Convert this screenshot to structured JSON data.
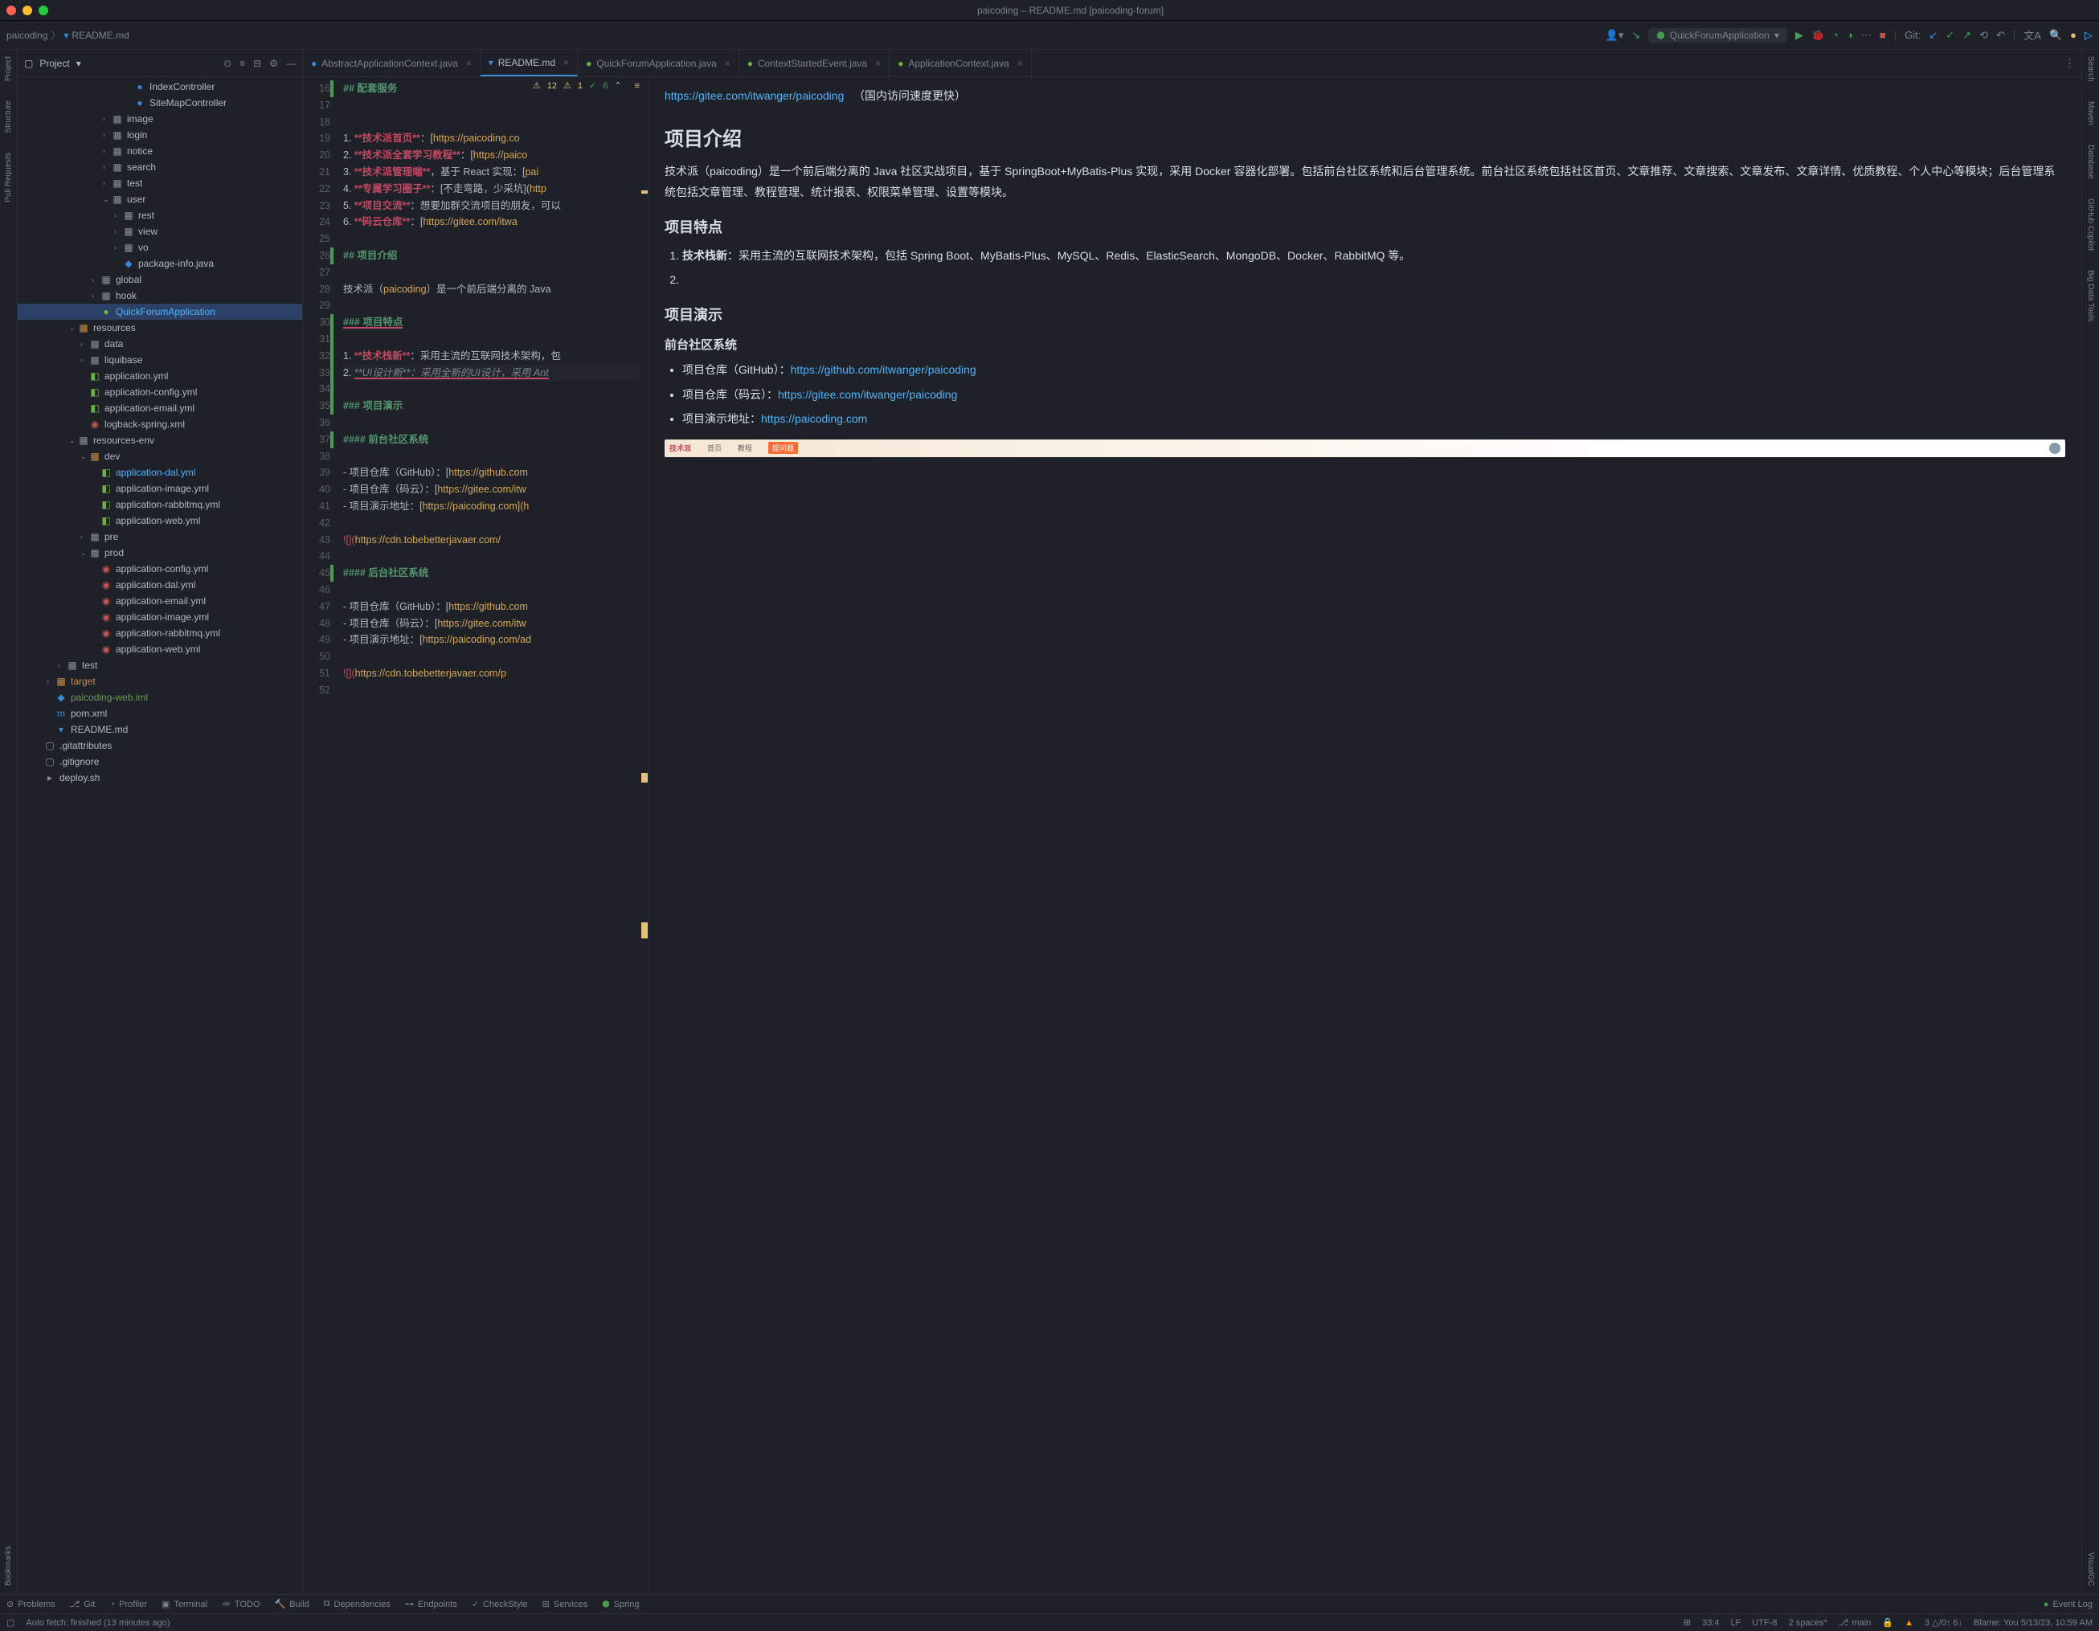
{
  "window": {
    "title": "paicoding – README.md [paicoding-forum]"
  },
  "breadcrumb": {
    "project": "paicoding",
    "file": "README.md"
  },
  "runConfig": {
    "name": "QuickForumApplication"
  },
  "git": {
    "label": "Git:"
  },
  "leftRail": [
    "Project",
    "Structure",
    "Pull Requests",
    "Bookmarks"
  ],
  "rightRail": [
    "Search",
    "Maven",
    "Database",
    "GitHub Copilot",
    "Big Data Tools",
    "VisualGC"
  ],
  "projectPanel": {
    "title": "Project"
  },
  "tree": {
    "items": [
      {
        "indent": 9,
        "arrow": "",
        "icon": "●",
        "iconClass": "java-icon",
        "label": "IndexController"
      },
      {
        "indent": 9,
        "arrow": "",
        "icon": "●",
        "iconClass": "java-icon",
        "label": "SiteMapController"
      },
      {
        "indent": 7,
        "arrow": "›",
        "icon": "▦",
        "iconClass": "dir-icon",
        "label": "image"
      },
      {
        "indent": 7,
        "arrow": "›",
        "icon": "▦",
        "iconClass": "dir-icon",
        "label": "login"
      },
      {
        "indent": 7,
        "arrow": "›",
        "icon": "▦",
        "iconClass": "dir-icon",
        "label": "notice"
      },
      {
        "indent": 7,
        "arrow": "›",
        "icon": "▦",
        "iconClass": "dir-icon",
        "label": "search"
      },
      {
        "indent": 7,
        "arrow": "›",
        "icon": "▦",
        "iconClass": "dir-icon",
        "label": "test"
      },
      {
        "indent": 7,
        "arrow": "⌄",
        "icon": "▦",
        "iconClass": "dir-icon",
        "label": "user"
      },
      {
        "indent": 8,
        "arrow": "›",
        "icon": "▦",
        "iconClass": "dir-icon",
        "label": "rest"
      },
      {
        "indent": 8,
        "arrow": "›",
        "icon": "▦",
        "iconClass": "dir-icon",
        "label": "view"
      },
      {
        "indent": 8,
        "arrow": "›",
        "icon": "▦",
        "iconClass": "dir-icon",
        "label": "vo"
      },
      {
        "indent": 8,
        "arrow": "",
        "icon": "◆",
        "iconClass": "java-icon",
        "label": "package-info.java"
      },
      {
        "indent": 6,
        "arrow": "›",
        "icon": "▦",
        "iconClass": "dir-icon",
        "label": "global"
      },
      {
        "indent": 6,
        "arrow": "›",
        "icon": "▦",
        "iconClass": "dir-icon",
        "label": "hook"
      },
      {
        "indent": 6,
        "arrow": "",
        "icon": "●",
        "iconClass": "spring-icon",
        "label": "QuickForumApplication",
        "labelClass": "blue",
        "selected": true
      },
      {
        "indent": 4,
        "arrow": "⌄",
        "icon": "▦",
        "iconClass": "res-icon",
        "label": "resources"
      },
      {
        "indent": 5,
        "arrow": "›",
        "icon": "▦",
        "iconClass": "dir-icon",
        "label": "data"
      },
      {
        "indent": 5,
        "arrow": "›",
        "icon": "▦",
        "iconClass": "dir-icon",
        "label": "liquibase"
      },
      {
        "indent": 5,
        "arrow": "",
        "icon": "◧",
        "iconClass": "spring-icon",
        "label": "application.yml"
      },
      {
        "indent": 5,
        "arrow": "",
        "icon": "◧",
        "iconClass": "spring-icon",
        "label": "application-config.yml"
      },
      {
        "indent": 5,
        "arrow": "",
        "icon": "◧",
        "iconClass": "spring-icon",
        "label": "application-email.yml"
      },
      {
        "indent": 5,
        "arrow": "",
        "icon": "◉",
        "iconClass": "yml-icon",
        "label": "logback-spring.xml"
      },
      {
        "indent": 4,
        "arrow": "⌄",
        "icon": "▦",
        "iconClass": "dir-icon",
        "label": "resources-env"
      },
      {
        "indent": 5,
        "arrow": "⌄",
        "icon": "▦",
        "iconClass": "res-icon",
        "label": "dev"
      },
      {
        "indent": 6,
        "arrow": "",
        "icon": "◧",
        "iconClass": "spring-icon",
        "label": "application-dal.yml",
        "labelClass": "blue"
      },
      {
        "indent": 6,
        "arrow": "",
        "icon": "◧",
        "iconClass": "spring-icon",
        "label": "application-image.yml"
      },
      {
        "indent": 6,
        "arrow": "",
        "icon": "◧",
        "iconClass": "spring-icon",
        "label": "application-rabbitmq.yml"
      },
      {
        "indent": 6,
        "arrow": "",
        "icon": "◧",
        "iconClass": "spring-icon",
        "label": "application-web.yml"
      },
      {
        "indent": 5,
        "arrow": "›",
        "icon": "▦",
        "iconClass": "dir-icon",
        "label": "pre"
      },
      {
        "indent": 5,
        "arrow": "⌄",
        "icon": "▦",
        "iconClass": "dir-icon",
        "label": "prod"
      },
      {
        "indent": 6,
        "arrow": "",
        "icon": "◉",
        "iconClass": "yml-icon",
        "label": "application-config.yml"
      },
      {
        "indent": 6,
        "arrow": "",
        "icon": "◉",
        "iconClass": "yml-icon",
        "label": "application-dal.yml"
      },
      {
        "indent": 6,
        "arrow": "",
        "icon": "◉",
        "iconClass": "yml-icon",
        "label": "application-email.yml"
      },
      {
        "indent": 6,
        "arrow": "",
        "icon": "◉",
        "iconClass": "yml-icon",
        "label": "application-image.yml"
      },
      {
        "indent": 6,
        "arrow": "",
        "icon": "◉",
        "iconClass": "yml-icon",
        "label": "application-rabbitmq.yml"
      },
      {
        "indent": 6,
        "arrow": "",
        "icon": "◉",
        "iconClass": "yml-icon",
        "label": "application-web.yml"
      },
      {
        "indent": 3,
        "arrow": "›",
        "icon": "▦",
        "iconClass": "dir-icon",
        "label": "test"
      },
      {
        "indent": 2,
        "arrow": "›",
        "icon": "▦",
        "iconClass": "res-icon",
        "label": "target",
        "labelClass": "orange"
      },
      {
        "indent": 2,
        "arrow": "",
        "icon": "◆",
        "iconClass": "java-icon",
        "label": "paicoding-web.iml",
        "labelClass": "green"
      },
      {
        "indent": 2,
        "arrow": "",
        "icon": "m",
        "iconClass": "java-icon",
        "label": "pom.xml"
      },
      {
        "indent": 2,
        "arrow": "",
        "icon": "▾",
        "iconClass": "java-icon",
        "label": "README.md"
      },
      {
        "indent": 1,
        "arrow": "",
        "icon": "▢",
        "iconClass": "dir-icon",
        "label": ".gitattributes"
      },
      {
        "indent": 1,
        "arrow": "",
        "icon": "▢",
        "iconClass": "dir-icon",
        "label": ".gitignore"
      },
      {
        "indent": 1,
        "arrow": "",
        "icon": "▸",
        "iconClass": "dir-icon",
        "label": "deploy.sh"
      }
    ]
  },
  "editorTabs": [
    {
      "icon": "●",
      "iconClass": "java-icon",
      "label": "AbstractApplicationContext.java",
      "active": false
    },
    {
      "icon": "▾",
      "iconClass": "file-icon",
      "label": "README.md",
      "active": true
    },
    {
      "icon": "●",
      "iconClass": "spring-icon",
      "label": "QuickForumApplication.java",
      "active": false
    },
    {
      "icon": "●",
      "iconClass": "spring-icon",
      "label": "ContextStartedEvent.java",
      "active": false
    },
    {
      "icon": "●",
      "iconClass": "spring-icon",
      "label": "ApplicationContext.java",
      "active": false
    }
  ],
  "codeInspection": {
    "warn1": "12",
    "warn2": "1",
    "ok": "6"
  },
  "codeLines": [
    {
      "n": 16,
      "mod": true,
      "html": "<span class='md-h'>## 配套服务</span>"
    },
    {
      "n": 17,
      "html": ""
    },
    {
      "n": 18,
      "html": ""
    },
    {
      "n": 19,
      "html": "<span class='md-num'>1. </span><span class='md-bold'>**技术派首页**</span><span class='md-text'>：[</span><span class='md-link'>https://paicoding.co</span>"
    },
    {
      "n": 20,
      "html": "<span class='md-num'>2. </span><span class='md-bold'>**技术派全套学习教程**</span><span class='md-text'>：[</span><span class='md-link'>https://paico</span>"
    },
    {
      "n": 21,
      "html": "<span class='md-num'>3. </span><span class='md-bold'>**技术派管理端**</span><span class='md-text'>，基于 React 实现：[</span><span class='md-link'>pai</span>"
    },
    {
      "n": 22,
      "html": "<span class='md-num'>4. </span><span class='md-bold'>**专属学习圈子**</span><span class='md-text'>：[不走弯路，少采坑](</span><span class='md-link'>http</span>"
    },
    {
      "n": 23,
      "html": "<span class='md-num'>5. </span><span class='md-bold'>**项目交流**</span><span class='md-text'>：想要加群交流项目的朋友，可以</span>"
    },
    {
      "n": 24,
      "html": "<span class='md-num'>6. </span><span class='md-bold'>**码云仓库**</span><span class='md-text'>：[</span><span class='md-link'>https://gitee.com/itwa</span>"
    },
    {
      "n": 25,
      "html": ""
    },
    {
      "n": 26,
      "mod": true,
      "html": "<span class='md-h'>## 项目介绍</span>"
    },
    {
      "n": 27,
      "html": ""
    },
    {
      "n": 28,
      "html": "<span class='md-text'>技术派（</span><span class='md-link'>paicoding</span><span class='md-text'>）是一个前后端分离的 Java </span>"
    },
    {
      "n": 29,
      "html": ""
    },
    {
      "n": 30,
      "mod": true,
      "html": "<span class='md-h underline-red'>### 项目特点</span>"
    },
    {
      "n": 31,
      "mod": true,
      "html": ""
    },
    {
      "n": 32,
      "mod": true,
      "html": "<span class='md-num'>1. </span><span class='md-bold'>**技术栈新**</span><span class='md-text'>：采用主流的互联网技术架构，包</span>"
    },
    {
      "n": 33,
      "mod": true,
      "current": true,
      "html": "<span class='md-num'>2. </span><span class='md-italic underline-red'>**UI设计新**：采用全新的UI设计，采用 Ant</span>"
    },
    {
      "n": 34,
      "mod": true,
      "html": ""
    },
    {
      "n": 35,
      "mod": true,
      "html": "<span class='md-h'>### 项目演示</span>"
    },
    {
      "n": 36,
      "html": ""
    },
    {
      "n": 37,
      "mod": true,
      "html": "<span class='md-h'>#### 前台社区系统</span>"
    },
    {
      "n": 38,
      "html": ""
    },
    {
      "n": 39,
      "html": "<span class='md-text'>- 项目仓库（GitHub）：[</span><span class='md-link'>https://github.com</span>"
    },
    {
      "n": 40,
      "html": "<span class='md-text'>- 项目仓库（码云）：[</span><span class='md-link'>https://gitee.com/itw</span>"
    },
    {
      "n": 41,
      "html": "<span class='md-text'>- 项目演示地址：[</span><span class='md-link'>https://paicoding.com](h</span>"
    },
    {
      "n": 42,
      "html": ""
    },
    {
      "n": 43,
      "gutterIcon": "▭",
      "html": "<span class='md-img'>![](</span><span class='md-link'>https://cdn.tobebetterjavaer.com/</span>"
    },
    {
      "n": 44,
      "html": ""
    },
    {
      "n": 45,
      "mod": true,
      "html": "<span class='md-h'>#### 后台社区系统</span>"
    },
    {
      "n": 46,
      "html": ""
    },
    {
      "n": 47,
      "html": "<span class='md-text'>- 项目仓库（GitHub）：[</span><span class='md-link'>https://github.com</span>"
    },
    {
      "n": 48,
      "html": "<span class='md-text'>- 项目仓库（码云）：[</span><span class='md-link'>https://gitee.com/itw</span>"
    },
    {
      "n": 49,
      "html": "<span class='md-text'>- 项目演示地址：[</span><span class='md-link'>https://paicoding.com/ad</span>"
    },
    {
      "n": 50,
      "html": ""
    },
    {
      "n": 51,
      "gutterIcon": "▭",
      "html": "<span class='md-img'>![](</span><span class='md-link'>https://cdn.tobebetterjavaer.com/p</span>"
    },
    {
      "n": 52,
      "html": ""
    }
  ],
  "preview": {
    "giteeLink": "https://gitee.com/itwanger/paicoding",
    "giteeNote": "（国内访问速度更快）",
    "h2_intro": "项目介绍",
    "intro_p": "技术派（paicoding）是一个前后端分离的 Java 社区实战项目，基于 SpringBoot+MyBatis-Plus 实现，采用 Docker 容器化部署。包括前台社区系统和后台管理系统。前台社区系统包括社区首页、文章推荐、文章搜索、文章发布、文章详情、优质教程、个人中心等模块；后台管理系统包括文章管理、教程管理、统计报表、权限菜单管理、设置等模块。",
    "h3_features": "项目特点",
    "feature_1_bold": "技术栈新",
    "feature_1_text": "：采用主流的互联网技术架构，包括 Spring Boot、MyBatis-Plus、MySQL、Redis、ElasticSearch、MongoDB、Docker、RabbitMQ 等。",
    "h3_demo": "项目演示",
    "h4_front": "前台社区系统",
    "front_github_label": "项目仓库（GitHub）：",
    "front_github_link": "https://github.com/itwanger/paicoding",
    "front_gitee_label": "项目仓库（码云）：",
    "front_gitee_link": "https://gitee.com/itwanger/paicoding",
    "front_demo_label": "项目演示地址：",
    "front_demo_link": "https://paicoding.com",
    "img_brand": "技术派",
    "img_nav1": "首页",
    "img_nav2": "教程",
    "img_btn": "提问题"
  },
  "toolBar": {
    "problems": "Problems",
    "git": "Git",
    "profiler": "Profiler",
    "terminal": "Terminal",
    "todo": "TODO",
    "build": "Build",
    "dependencies": "Dependencies",
    "endpoints": "Endpoints",
    "checkstyle": "CheckStyle",
    "services": "Services",
    "spring": "Spring",
    "eventlog": "Event Log"
  },
  "statusBar": {
    "autofetch": "Auto fetch: finished (13 minutes ago)",
    "cursor": "33:4",
    "lineEnding": "LF",
    "encoding": "UTF-8",
    "indent": "2 spaces*",
    "branch": "main",
    "changes": "3 △/0↑ 6↓",
    "blame": "Blame: You 5/13/23, 10:59 AM"
  }
}
